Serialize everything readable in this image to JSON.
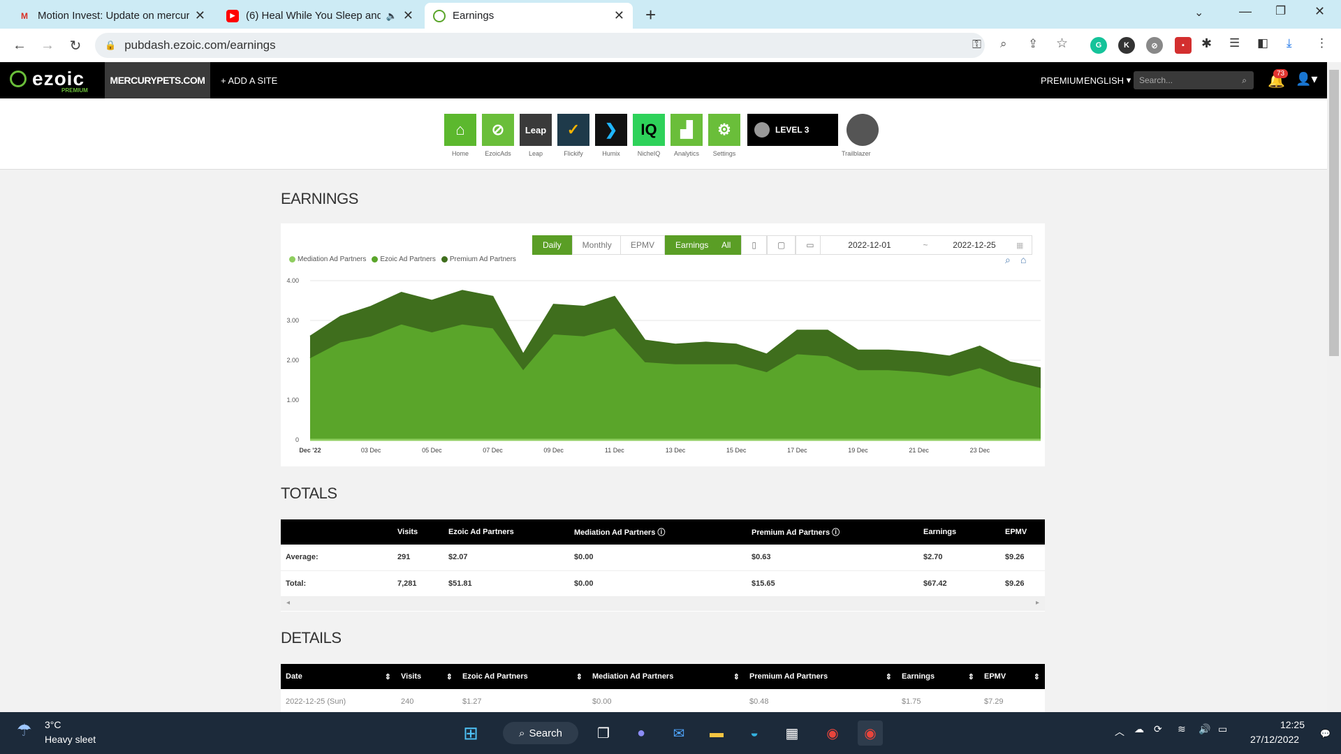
{
  "browser": {
    "tabs": [
      {
        "title": "Motion Invest: Update on mercur",
        "icon": "gmail-icon"
      },
      {
        "title": "(6) Heal While You Sleep and",
        "icon": "youtube-icon"
      },
      {
        "title": "Earnings",
        "icon": "ezoic-icon"
      }
    ],
    "url": "pubdash.ezoic.com/earnings"
  },
  "header": {
    "logo": "ezoic",
    "logo_sub": "PREMIUM",
    "site": "MERCURYPETS.COM",
    "add_site": "+ ADD A SITE",
    "premium": "PREMIUM",
    "language": "ENGLISH",
    "search_placeholder": "Search...",
    "notifications": "73"
  },
  "apps": [
    {
      "label": "Home",
      "color": "#5cb82e",
      "glyph": "⌂"
    },
    {
      "label": "EzoicAds",
      "color": "#6abe3a",
      "glyph": "⊘"
    },
    {
      "label": "Leap",
      "color": "#3a3a3a",
      "glyph": "Leap"
    },
    {
      "label": "Flickify",
      "color": "#1e3a4a",
      "glyph": "✓"
    },
    {
      "label": "Humix",
      "color": "#111111",
      "glyph": "❯"
    },
    {
      "label": "NicheIQ",
      "color": "#2ed25a",
      "glyph": "IQ"
    },
    {
      "label": "Analytics",
      "color": "#6abe3a",
      "glyph": "▟"
    },
    {
      "label": "Settings",
      "color": "#6abe3a",
      "glyph": "⚙"
    }
  ],
  "level": "LEVEL 3",
  "trailblazer": "Trailblazer",
  "earnings": {
    "title": "EARNINGS",
    "buttons": {
      "daily": "Daily",
      "monthly": "Monthly",
      "epmv": "EPMV",
      "earnings": "Earnings",
      "all": "All"
    },
    "date_from": "2022-12-01",
    "date_sep": "~",
    "date_to": "2022-12-25"
  },
  "chart_data": {
    "type": "area",
    "stacked": true,
    "x_ticks": [
      "Dec '22",
      "03 Dec",
      "05 Dec",
      "07 Dec",
      "09 Dec",
      "11 Dec",
      "13 Dec",
      "15 Dec",
      "17 Dec",
      "19 Dec",
      "21 Dec",
      "23 Dec"
    ],
    "y_ticks": [
      "0",
      "1.00",
      "2.00",
      "3.00",
      "4.00"
    ],
    "ylim": [
      0,
      4
    ],
    "days": [
      1,
      2,
      3,
      4,
      5,
      6,
      7,
      8,
      9,
      10,
      11,
      12,
      13,
      14,
      15,
      16,
      17,
      18,
      19,
      20,
      21,
      22,
      23,
      24,
      25
    ],
    "series": [
      {
        "name": "Mediation Ad Partners",
        "color": "#8fce5f",
        "values": [
          0,
          0,
          0,
          0,
          0,
          0,
          0,
          0,
          0,
          0,
          0,
          0,
          0,
          0,
          0,
          0,
          0,
          0,
          0,
          0,
          0,
          0,
          0,
          0,
          0
        ]
      },
      {
        "name": "Ezoic Ad Partners",
        "color": "#5aa52a",
        "values": [
          2.05,
          2.45,
          2.6,
          2.9,
          2.7,
          2.9,
          2.8,
          1.75,
          2.65,
          2.6,
          2.8,
          1.95,
          1.9,
          1.9,
          1.9,
          1.7,
          2.15,
          2.1,
          1.75,
          1.75,
          1.7,
          1.6,
          1.8,
          1.5,
          1.3
        ]
      },
      {
        "name": "Premium Ad Partners",
        "color": "#3f6e1d",
        "values": [
          0.55,
          0.65,
          0.75,
          0.8,
          0.8,
          0.85,
          0.8,
          0.4,
          0.75,
          0.75,
          0.8,
          0.55,
          0.5,
          0.55,
          0.5,
          0.45,
          0.6,
          0.65,
          0.5,
          0.5,
          0.5,
          0.5,
          0.55,
          0.45,
          0.5
        ]
      }
    ]
  },
  "totals": {
    "title": "TOTALS",
    "headers": [
      "",
      "Visits",
      "Ezoic Ad Partners",
      "Mediation Ad Partners",
      "Premium Ad Partners",
      "Earnings",
      "EPMV"
    ],
    "rows": [
      [
        "Average:",
        "291",
        "$2.07",
        "$0.00",
        "$0.63",
        "$2.70",
        "$9.26"
      ],
      [
        "Total:",
        "7,281",
        "$51.81",
        "$0.00",
        "$15.65",
        "$67.42",
        "$9.26"
      ]
    ]
  },
  "details": {
    "title": "DETAILS",
    "headers": [
      "Date",
      "Visits",
      "Ezoic Ad Partners",
      "Mediation Ad Partners",
      "Premium Ad Partners",
      "Earnings",
      "EPMV"
    ],
    "rows": [
      [
        "2022-12-25 (Sun)",
        "240",
        "$1.27",
        "$0.00",
        "$0.48",
        "$1.75",
        "$7.29"
      ]
    ]
  },
  "taskbar": {
    "temp": "3°C",
    "weather": "Heavy sleet",
    "search": "Search",
    "time": "12:25",
    "date": "27/12/2022"
  }
}
